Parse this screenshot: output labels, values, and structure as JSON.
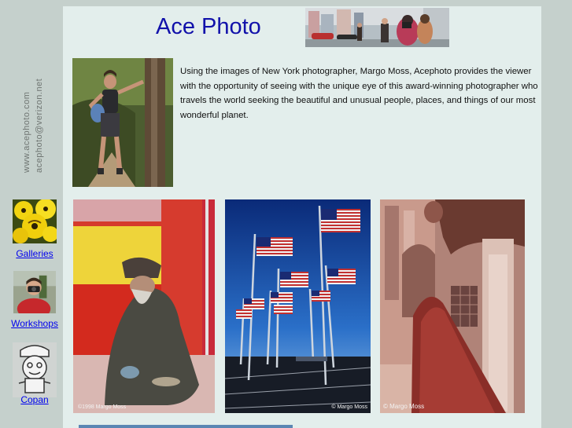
{
  "site": {
    "title": "Ace Photo",
    "url_text": "www.acephoto.com",
    "email_text": "acephoto@verizon.net"
  },
  "nav": [
    {
      "label": "Galleries",
      "icon": "yellow-pansies-thumbnail"
    },
    {
      "label": "Workshops",
      "icon": "photographer-thumbnail"
    },
    {
      "label": "Copan",
      "icon": "copan-sculpture-thumbnail"
    }
  ],
  "intro": {
    "text": "Using the images of New York photographer, Margo Moss, Acephoto provides the viewer with the opportunity of seeing with the unique eye of this award-winning photographer who travels the world seeking the beautiful and unusual people, places, and things of our most wonderful planet."
  },
  "photos": {
    "credit1": "©1998 Margo Moss",
    "credit2": "© Margo Moss",
    "credit3": "© Margo Moss"
  },
  "colors": {
    "background": "#c5d0cc",
    "panel": "#e3eeec",
    "title": "#1111aa",
    "link": "#0000ee"
  }
}
